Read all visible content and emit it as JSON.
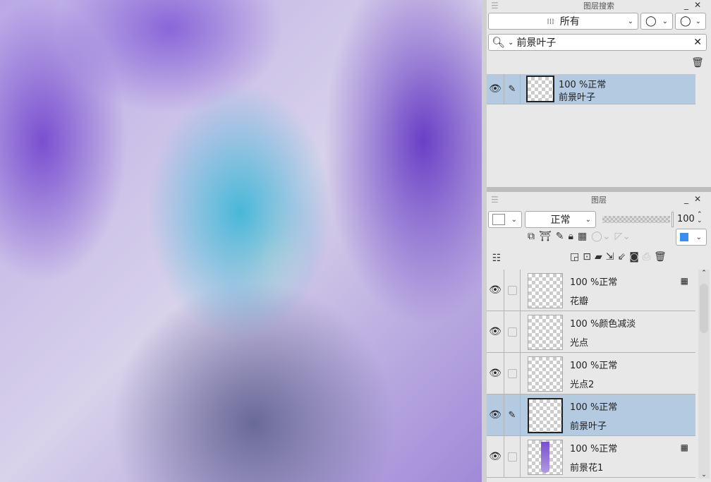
{
  "canvas": {
    "description_alt": "artwork"
  },
  "search_panel": {
    "title": "图层搜索",
    "filter_value": "所有",
    "search_value": "前景叶子",
    "results": [
      {
        "opacity_mode": "100 %正常",
        "name": "前景叶子"
      }
    ]
  },
  "layer_panel": {
    "title": "图层",
    "blend_mode": "正常",
    "opacity": "100",
    "layers": [
      {
        "opacity_mode": "100 %正常",
        "name": "花瓣",
        "locked": true
      },
      {
        "opacity_mode": "100 %颜色减淡",
        "name": "光点",
        "locked": false
      },
      {
        "opacity_mode": "100 %正常",
        "name": "光点2",
        "locked": false
      },
      {
        "opacity_mode": "100 %正常",
        "name": "前景叶子",
        "locked": false,
        "selected": true
      },
      {
        "opacity_mode": "100 %正常",
        "name": "前景花1",
        "locked": true
      }
    ]
  },
  "colors": {
    "selected_row": "#b3cae0",
    "accent_blue": "#3b8ef0"
  }
}
